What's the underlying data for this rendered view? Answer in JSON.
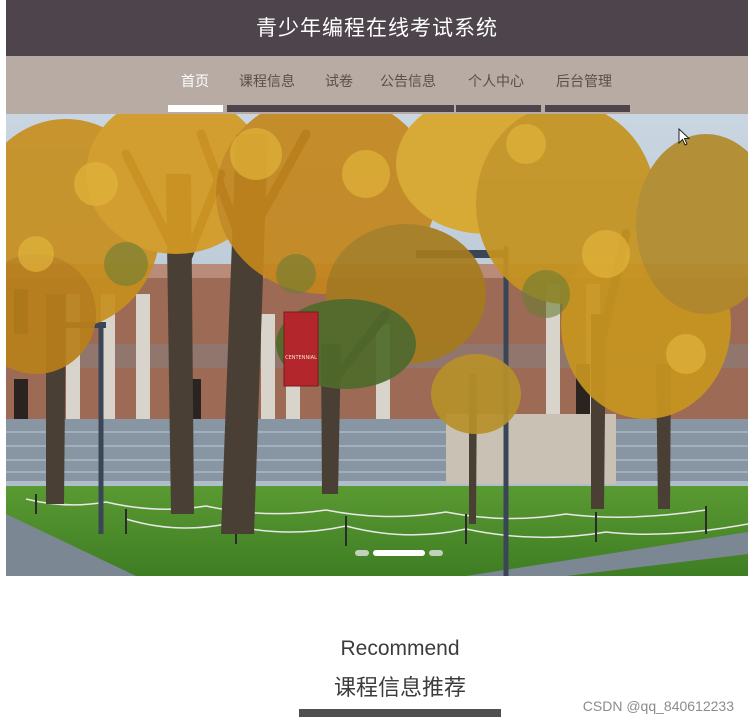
{
  "header": {
    "title": "青少年编程在线考试系统"
  },
  "nav": {
    "items": [
      {
        "label": "首页",
        "active": true
      },
      {
        "label": "课程信息",
        "active": false
      },
      {
        "label": "试卷",
        "active": false
      },
      {
        "label": "公告信息",
        "active": false
      },
      {
        "label": "个人中心",
        "active": false
      },
      {
        "label": "后台管理",
        "active": false
      }
    ]
  },
  "banner": {
    "slide_count": 3,
    "active_slide": 2,
    "sign_text": "CENTENNIAL"
  },
  "recommend": {
    "title_en": "Recommend",
    "title_zh": "课程信息推荐"
  },
  "watermark": "CSDN @qq_840612233",
  "colors": {
    "header_bg": "#4d454b",
    "nav_bg": "#b8aba3",
    "nav_text": "#5b4f4c",
    "accent": "#ffffff"
  }
}
